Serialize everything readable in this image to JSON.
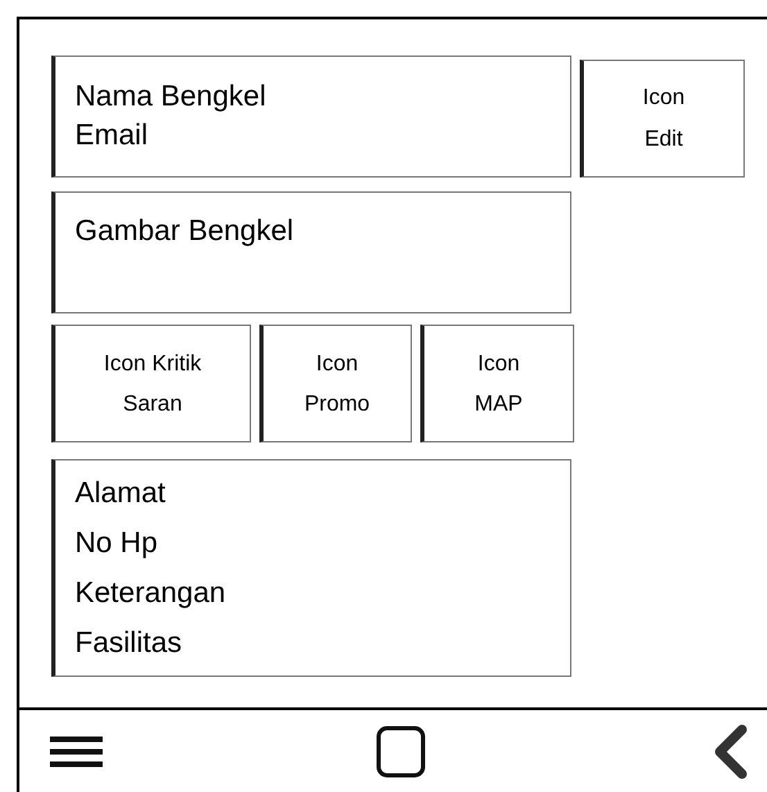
{
  "header": {
    "lines": [
      "Nama Bengkel",
      "Email"
    ]
  },
  "edit_button": {
    "lines": [
      "Icon",
      "Edit"
    ]
  },
  "image_box": {
    "label": "Gambar Bengkel"
  },
  "action_buttons": [
    {
      "lines": [
        "Icon Kritik",
        "Saran"
      ]
    },
    {
      "lines": [
        "Icon",
        "Promo"
      ]
    },
    {
      "lines": [
        "Icon",
        "MAP"
      ]
    }
  ],
  "info": {
    "lines": [
      "Alamat",
      "No Hp",
      "Keterangan",
      "Fasilitas"
    ]
  }
}
